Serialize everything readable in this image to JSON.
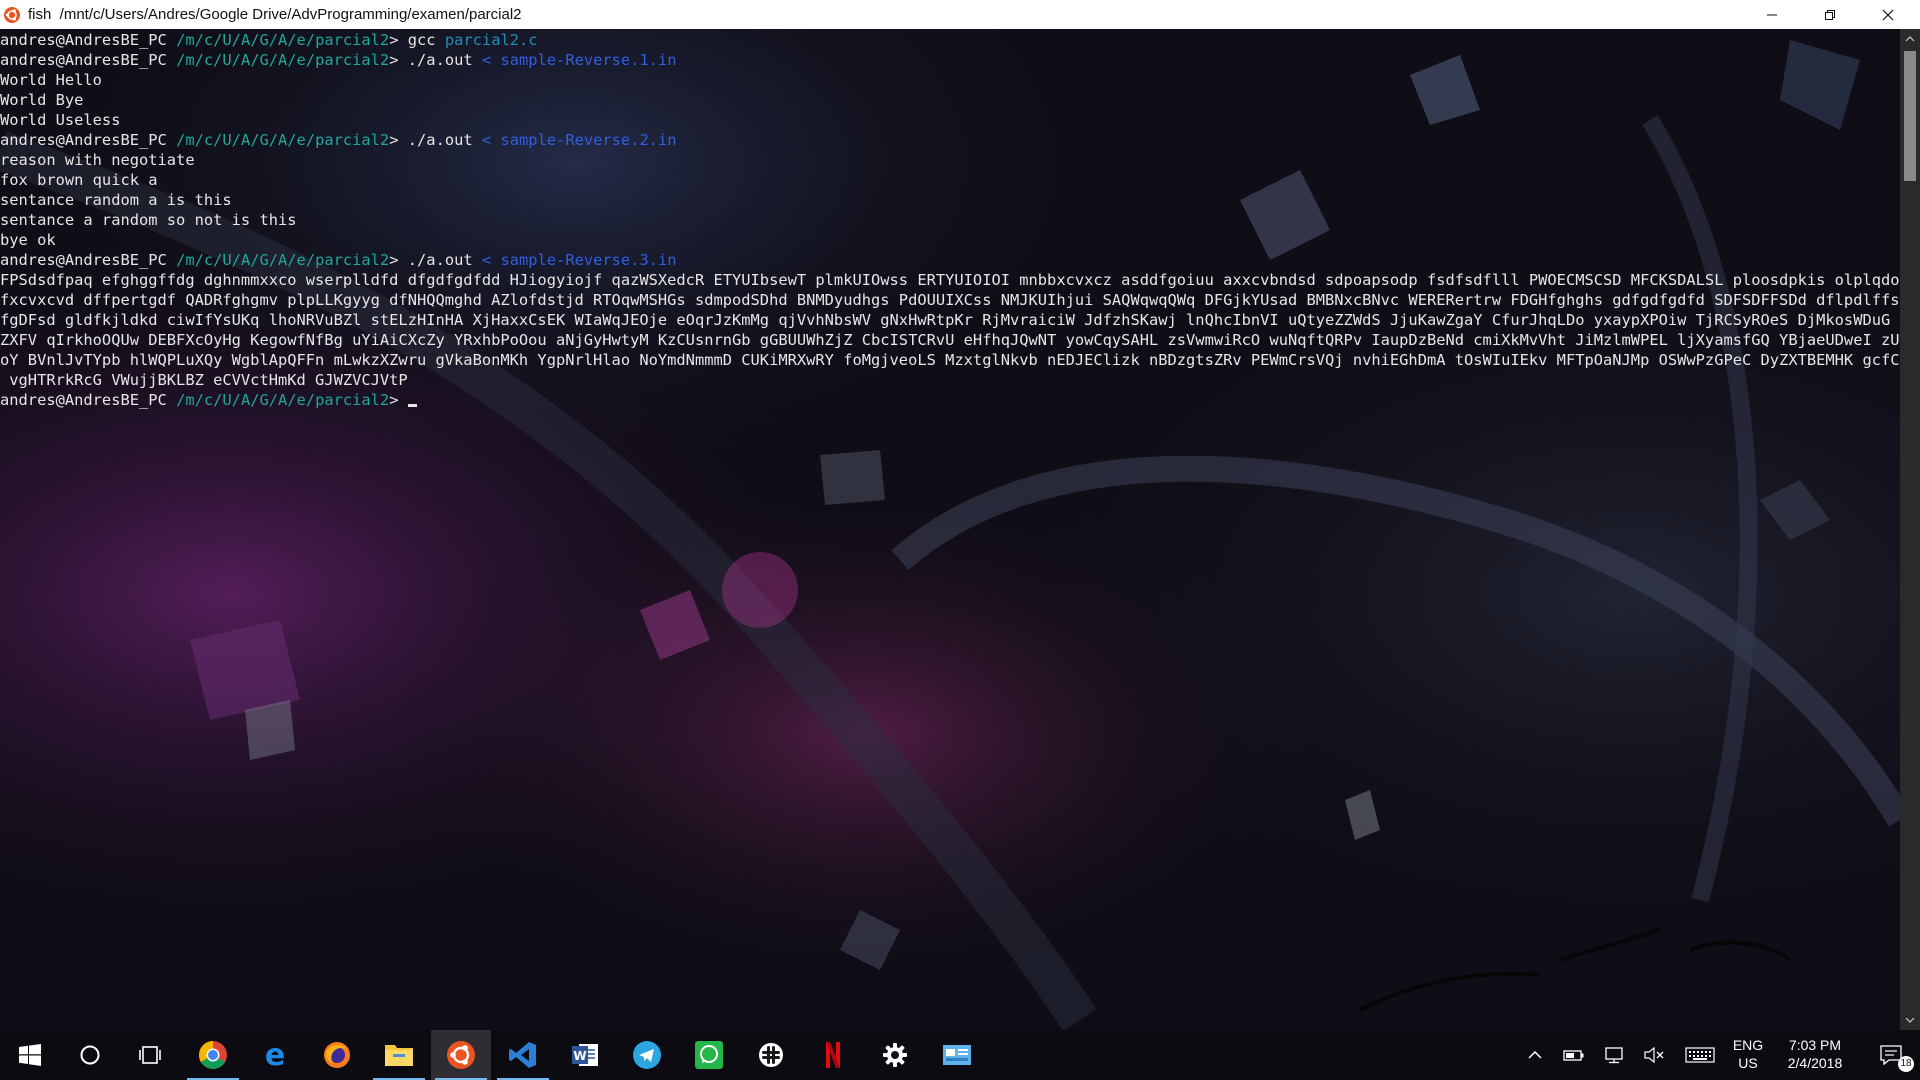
{
  "window": {
    "title": "fish  /mnt/c/Users/Andres/Google Drive/AdvProgramming/examen/parcial2"
  },
  "terminal": {
    "prompt_user": "andres@AndresBE_PC",
    "prompt_path": "/m/c/U/A/G/A/e/parcial2",
    "prompt_symbol": ">",
    "lines": [
      {
        "type": "prompt",
        "cmd": "gcc",
        "arg": "parcial2.c",
        "redir": ""
      },
      {
        "type": "prompt",
        "cmd": "./a.out",
        "arg": "",
        "redir": "< sample-Reverse.1.in"
      },
      {
        "type": "output",
        "text": "World Hello"
      },
      {
        "type": "output",
        "text": "World Bye"
      },
      {
        "type": "output",
        "text": "World Useless"
      },
      {
        "type": "prompt",
        "cmd": "./a.out",
        "arg": "",
        "redir": "< sample-Reverse.2.in"
      },
      {
        "type": "output",
        "text": "reason with negotiate"
      },
      {
        "type": "output",
        "text": "fox brown quick a"
      },
      {
        "type": "output",
        "text": "sentance random a is this"
      },
      {
        "type": "output",
        "text": "sentance a random so not is this"
      },
      {
        "type": "output",
        "text": "bye ok"
      },
      {
        "type": "prompt",
        "cmd": "./a.out",
        "arg": "",
        "redir": "< sample-Reverse.3.in"
      },
      {
        "type": "output",
        "text": "FPSdsdfpaq efghggffdg dghnmmxxco wserplldfd dfgdfgdfdd HJiogyiojf qazWSXedcR ETYUIbsewT plmkUIOwss ERTYUIOIOI mnbbxcvxcz asddfgoiuu axxcvbndsd sdpoapsodp fsdfsdflll PWOECMSCSD MFCKSDALSL ploosdpkis olplqdoiie sd"
      },
      {
        "type": "output",
        "text": "fxcvxcvd dffpertgdf QADRfghgmv plpLLKgyyg dfNHQQmghd AZlofdstjd RTOqwMSHGs sdmpodSDhd BNMDyudhgs PdOUUIXCss NMJKUIhjui SAQWqwqQWq DFGjkYUsad BMBNxcBNvc WERERertrw FDGHfghghs gdfgdfgdfd SDFSDFFSDd dflpdlffss pfdo"
      },
      {
        "type": "output",
        "text": "fgDFsd gldfkjldkd ciwIfYsUKq lhoNRVuBZl stELzHInHA XjHaxxCsEK WIaWqJEOje eOqrJzKmMg qjVvhNbsWV gNxHwRtpKr RjMvraiciW JdfzhSKawj lnQhcIbnVI uQtyeZZWdS JjuKawZgaY CfurJhqLDo yxaypXPOiw TjRCSyROeS DjMkosWDuG JqHAtg"
      },
      {
        "type": "output",
        "text": "ZXFV qIrkhoOQUw DEBFXcOyHg KegowfNfBg uYiAiCXcZy YRxhbPoOou aNjGyHwtyM KzCUsnrnGb gGBUUWhZjZ CbcISTCRvU eHfhqJQwNT yowCqySAHL zsVwmwiRcO wuNqftQRPv IaupDzBeNd cmiXkMvVht JiMzlmWPEL ljXyamsfGQ YBjaeUDweI zUckgxDl"
      },
      {
        "type": "output",
        "text": "oY BVnlJvTYpb hlWQPLuXQy WgblApQFFn mLwkzXZwru gVkaBonMKh YgpNrlHlao NoYmdNmmmD CUKiMRXwRY foMgjveoLS MzxtglNkvb nEDJEClizk nBDzgtsZRv PEWmCrsVQj nvhiEGhDmA tOsWIuIEkv MFTpOaNJMp OSWwPzGPeC DyZXTBEMHK gcfCOImnle"
      },
      {
        "type": "output",
        "text": " vgHTRrkRcG VWujjBKLBZ eCVVctHmKd GJWZVCJVtP"
      },
      {
        "type": "prompt-current",
        "cmd": "",
        "arg": "",
        "redir": ""
      }
    ]
  },
  "taskbar": {
    "apps": [
      {
        "name": "start-button",
        "icon": "windows-icon"
      },
      {
        "name": "cortana-button",
        "icon": "cortana-circle-icon"
      },
      {
        "name": "task-view-button",
        "icon": "task-view-icon"
      },
      {
        "name": "taskbar-chrome",
        "icon": "chrome-icon"
      },
      {
        "name": "taskbar-edge",
        "icon": "edge-icon"
      },
      {
        "name": "taskbar-firefox",
        "icon": "firefox-icon"
      },
      {
        "name": "taskbar-file-explorer",
        "icon": "folder-icon"
      },
      {
        "name": "taskbar-ubuntu",
        "icon": "ubuntu-icon"
      },
      {
        "name": "taskbar-vscode",
        "icon": "vscode-icon"
      },
      {
        "name": "taskbar-word",
        "icon": "word-icon"
      },
      {
        "name": "taskbar-telegram",
        "icon": "telegram-icon"
      },
      {
        "name": "taskbar-whatsapp",
        "icon": "whatsapp-icon"
      },
      {
        "name": "taskbar-slack",
        "icon": "slack-icon"
      },
      {
        "name": "taskbar-netflix",
        "icon": "netflix-icon"
      },
      {
        "name": "taskbar-settings",
        "icon": "gear-icon"
      },
      {
        "name": "taskbar-control-panel",
        "icon": "control-panel-icon"
      }
    ],
    "tray": {
      "language_line1": "ENG",
      "language_line2": "US",
      "time": "7:03 PM",
      "date": "2/4/2018",
      "notification_count": "18"
    }
  },
  "colors": {
    "terminal_text": "#e6e6e6",
    "path": "#1fa79a",
    "argument": "#1f8fb8",
    "redirect": "#2f5fe0",
    "taskbar_accent": "#76b9ed"
  }
}
